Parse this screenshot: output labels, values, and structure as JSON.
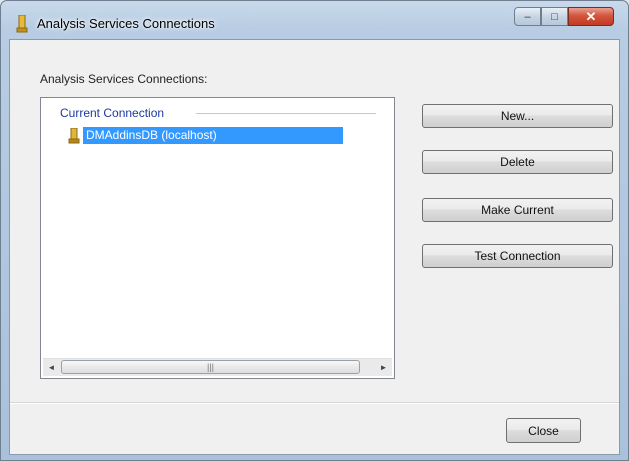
{
  "window": {
    "title": "Analysis Services Connections",
    "minimize_glyph": "–",
    "maximize_glyph": "□",
    "close_glyph": "✕"
  },
  "dialog": {
    "group_label": "Analysis Services Connections:",
    "tree": {
      "root_label": "Current Connection",
      "items": [
        {
          "label": "DMAddinsDB (localhost)",
          "selected": true,
          "icon": "server-icon"
        }
      ]
    },
    "scrollbar": {
      "left_arrow": "◄",
      "right_arrow": "►",
      "thumb_grip": "|||"
    },
    "buttons": {
      "new": "New...",
      "delete": "Delete",
      "make_current": "Make Current",
      "test_connection": "Test Connection"
    },
    "close_button": "Close"
  },
  "colors": {
    "selection": "#3399ff",
    "tree_root_text": "#1e3aa0"
  }
}
